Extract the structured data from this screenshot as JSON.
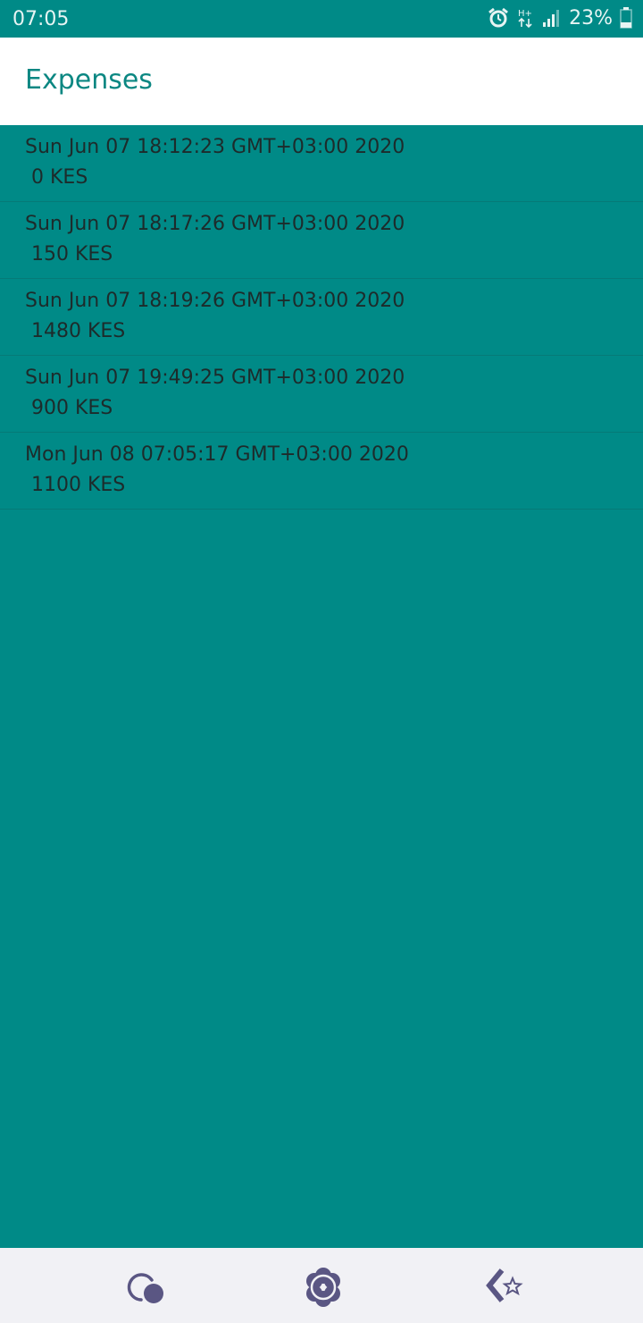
{
  "status_bar": {
    "time": "07:05",
    "network": "H+",
    "battery": "23%",
    "icons": [
      "alarm-icon",
      "network-hplus-icon",
      "signal-icon",
      "battery-icon"
    ]
  },
  "app_bar": {
    "title": "Expenses"
  },
  "expenses": [
    {
      "date": "Sun Jun 07 18:12:23 GMT+03:00 2020",
      "amount": "0 KES"
    },
    {
      "date": "Sun Jun 07 18:17:26 GMT+03:00 2020",
      "amount": "150 KES"
    },
    {
      "date": "Sun Jun 07 18:19:26 GMT+03:00 2020",
      "amount": "1480 KES"
    },
    {
      "date": "Sun Jun 07 19:49:25 GMT+03:00 2020",
      "amount": "900 KES"
    },
    {
      "date": "Mon Jun 08 07:05:17 GMT+03:00 2020",
      "amount": "1100 KES"
    }
  ],
  "nav_bar": {
    "icons": [
      "recent-apps-icon",
      "home-icon",
      "back-icon"
    ]
  },
  "colors": {
    "background": "#008a87",
    "app_bar": "#ffffff",
    "title": "#0b8782",
    "nav_bar": "#f1f1f5",
    "nav_icon": "#5a5683"
  }
}
